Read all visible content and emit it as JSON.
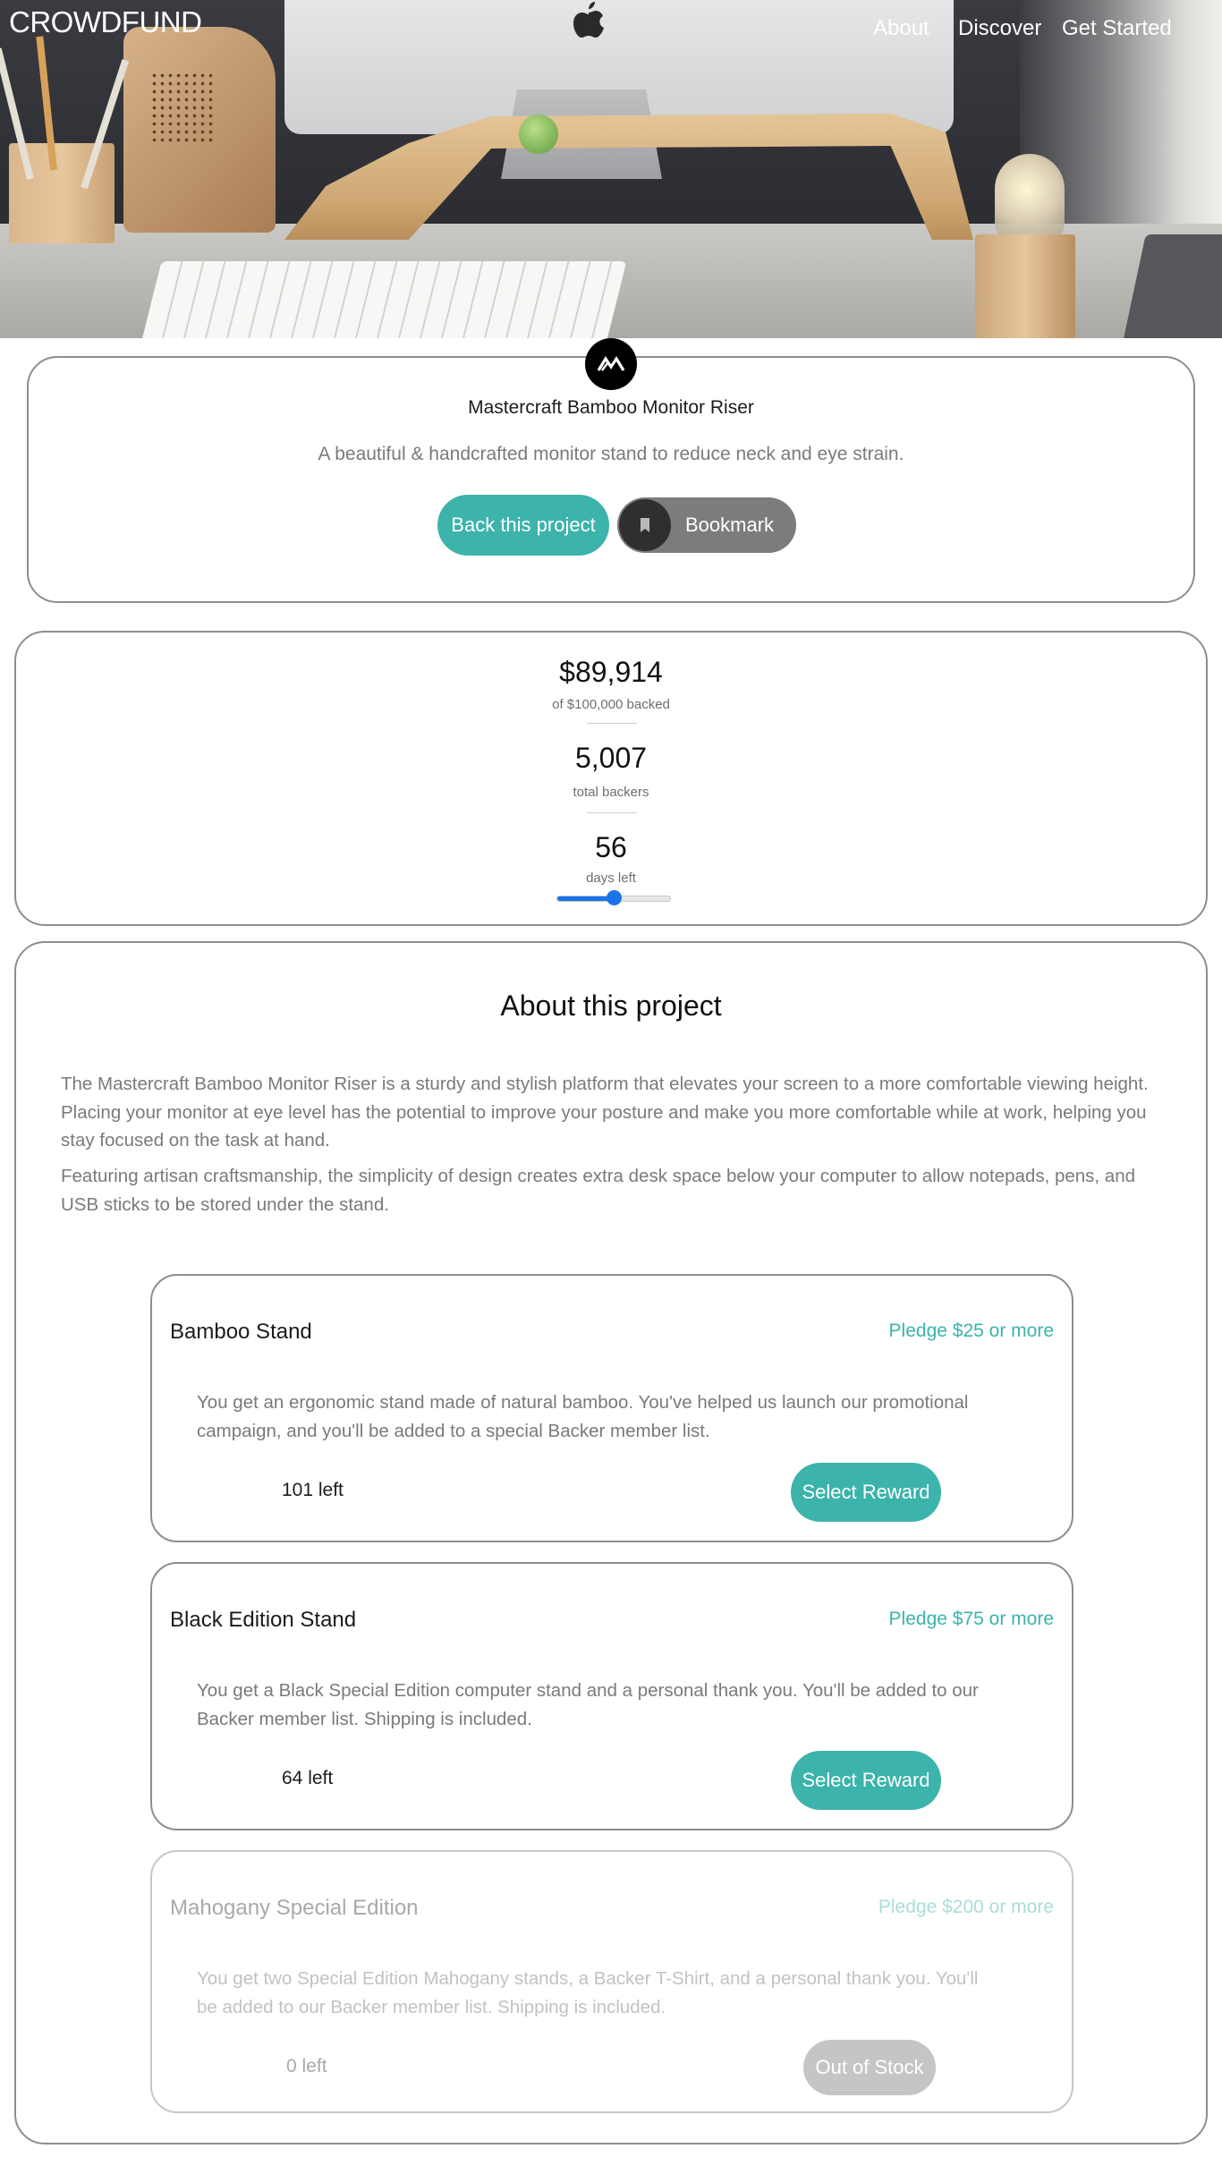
{
  "header": {
    "brand": "CROWDFUND",
    "nav": [
      {
        "label": "About"
      },
      {
        "label": "Discover"
      },
      {
        "label": "Get Started"
      }
    ]
  },
  "project": {
    "title": "Mastercraft Bamboo Monitor Riser",
    "description": "A beautiful & handcrafted monitor stand to reduce neck and eye strain.",
    "back_label": "Back this project",
    "bookmark_label": "Bookmark"
  },
  "stats": {
    "backed_amount": "$89,914",
    "backed_label": "of $100,000 backed",
    "backers": "5,007",
    "backers_label": "total backers",
    "days": "56",
    "days_label": "days left",
    "progress_fraction": 0.5
  },
  "about": {
    "title": "About this project",
    "paragraphs": [
      "The Mastercraft Bamboo Monitor Riser is a sturdy and stylish platform that elevates your screen to a more comfortable viewing height. Placing your monitor at eye level has the potential to improve your posture and make you more comfortable while at work, helping you stay focused on the task at hand.",
      "Featuring artisan craftsmanship, the simplicity of design creates extra desk space below your computer to allow notepads, pens, and USB sticks to be stored under the stand."
    ]
  },
  "rewards": [
    {
      "name": "Bamboo Stand",
      "pledge": "Pledge $25 or more",
      "description": "You get an ergonomic stand made of natural bamboo. You've helped us launch our promotional campaign, and you'll be added to a special Backer member list.",
      "left": "101 left",
      "button": "Select Reward"
    },
    {
      "name": "Black Edition Stand",
      "pledge": "Pledge $75 or more",
      "description": "You get a Black Special Edition computer stand and a personal thank you. You'll be added to our Backer member list. Shipping is included.",
      "left": "64 left",
      "button": "Select Reward"
    },
    {
      "name": "Mahogany Special Edition",
      "pledge": "Pledge $200 or more",
      "description": "You get two Special Edition Mahogany stands, a Backer T-Shirt, and a personal thank you. You'll be added to our Backer member list. Shipping is included.",
      "left": "0 left",
      "button": "Out of Stock"
    }
  ],
  "colors": {
    "accent": "#3cb3ab",
    "accent_muted": "#a8ddd9",
    "progress": "#1a73e8",
    "bookmark_bg": "#7c7c7c"
  },
  "icons": {
    "logo": "mastercraft-logo-icon",
    "bookmark": "bookmark-icon",
    "apple": "apple-logo-icon"
  }
}
